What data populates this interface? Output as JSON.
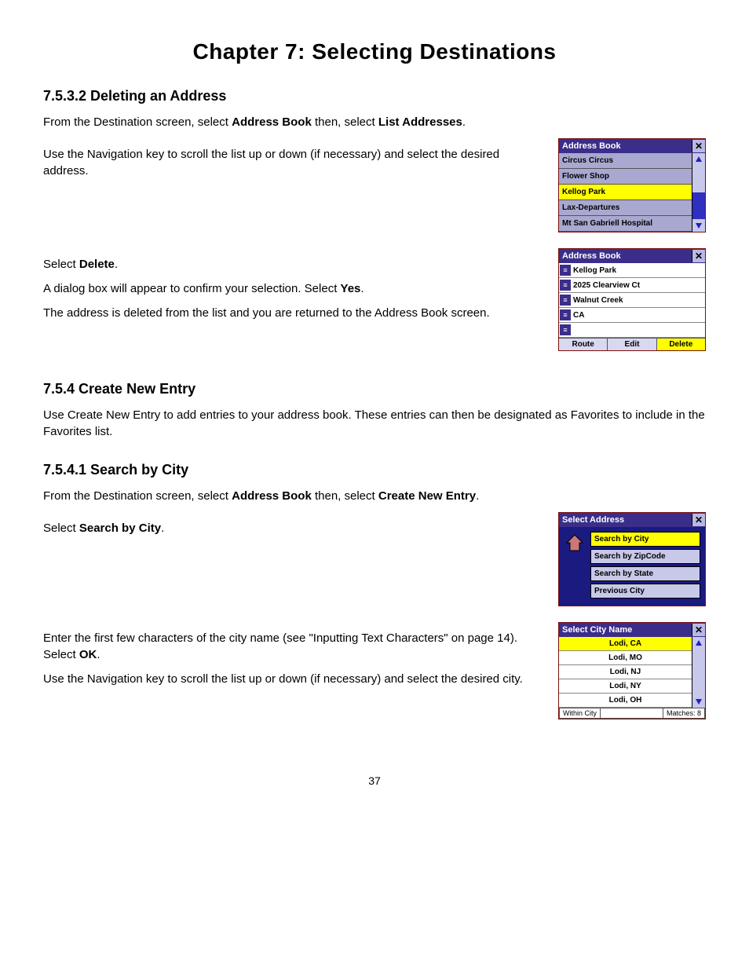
{
  "chapter_title": "Chapter 7: Selecting Destinations",
  "page_number": "37",
  "sections": {
    "s1_heading": "7.5.3.2 Deleting an Address",
    "s1_p1_a": "From the Destination screen, select ",
    "s1_p1_b1": "Address Book",
    "s1_p1_c": " then, select ",
    "s1_p1_b2": "List Addresses",
    "s1_p1_d": ".",
    "s1_p2": "Use the Navigation key to scroll the list up or down (if necessary) and select the desired address.",
    "s1_p3_a": "Select ",
    "s1_p3_b": "Delete",
    "s1_p3_c": ".",
    "s1_p4_a": "A dialog box will appear to confirm your selection. Select ",
    "s1_p4_b": "Yes",
    "s1_p4_c": ".",
    "s1_p5": "The address is deleted from the list and you are returned to the Address Book screen.",
    "s2_heading": "7.5.4 Create New Entry",
    "s2_p1": "Use Create New Entry to add entries to your address book. These entries can then be designated as Favorites to include in the Favorites list.",
    "s3_heading": "7.5.4.1 Search by City",
    "s3_p1_a": "From the Destination screen, select ",
    "s3_p1_b1": "Address Book",
    "s3_p1_c": " then, select ",
    "s3_p1_b2": "Create New Entry",
    "s3_p1_d": ".",
    "s3_p2_a": "Select ",
    "s3_p2_b": "Search by City",
    "s3_p2_c": ".",
    "s3_p3_a": "Enter the first few characters of the city name (see \"Inputting Text Characters\" on page 14). Select ",
    "s3_p3_b": "OK",
    "s3_p3_c": ".",
    "s3_p4": "Use the Navigation key to scroll the list up or down (if necessary) and select the desired city."
  },
  "fig1": {
    "title": "Address Book",
    "items": [
      "Circus Circus",
      "Flower Shop",
      "Kellog Park",
      "Lax-Departures",
      "Mt San Gabriell Hospital"
    ],
    "selected_index": 2
  },
  "fig2": {
    "title": "Address Book",
    "rows": [
      "Kellog Park",
      "2025 Clearview Ct",
      "Walnut Creek",
      "CA",
      ""
    ],
    "buttons": [
      "Route",
      "Edit",
      "Delete"
    ]
  },
  "fig3": {
    "title": "Select Address",
    "items": [
      "Search by City",
      "Search by ZipCode",
      "Search by State",
      "Previous City"
    ],
    "selected_index": 0
  },
  "fig4": {
    "title": "Select City Name",
    "items": [
      "Lodi, CA",
      "Lodi, MO",
      "Lodi, NJ",
      "Lodi, NY",
      "Lodi, OH"
    ],
    "selected_index": 0,
    "footer_left": "Within City",
    "footer_right": "Matches:  8"
  }
}
